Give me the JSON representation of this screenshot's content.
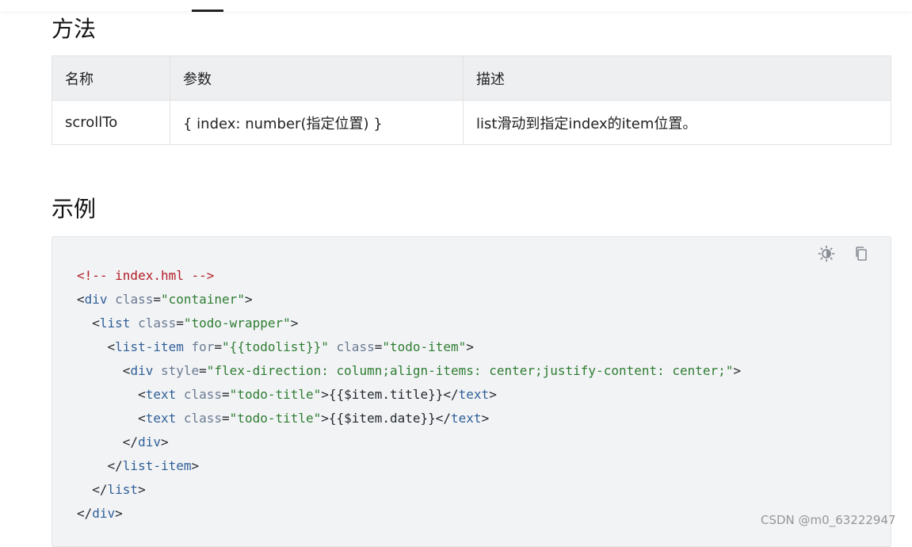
{
  "sections": {
    "methods_title": "方法",
    "example_title": "示例"
  },
  "methods_table": {
    "headers": [
      "名称",
      "参数",
      "描述"
    ],
    "rows": [
      [
        "scrollTo",
        "{ index: number(指定位置) }",
        "list滑动到指定index的item位置。"
      ]
    ]
  },
  "code_block": {
    "toolbar": {
      "theme_icon": "theme-toggle-icon",
      "copy_icon": "copy-icon"
    },
    "lines": [
      [
        [
          "comment",
          "<!-- index.hml -->"
        ]
      ],
      [
        [
          "text",
          "<"
        ],
        [
          "tag",
          "div"
        ],
        [
          "attr",
          " class"
        ],
        [
          "text",
          "="
        ],
        [
          "str",
          "\"container\""
        ],
        [
          "text",
          ">"
        ]
      ],
      [
        [
          "text",
          "  <"
        ],
        [
          "tag",
          "list"
        ],
        [
          "attr",
          " class"
        ],
        [
          "text",
          "="
        ],
        [
          "str",
          "\"todo-wrapper\""
        ],
        [
          "text",
          ">"
        ]
      ],
      [
        [
          "text",
          "    <"
        ],
        [
          "tag",
          "list-item"
        ],
        [
          "attr",
          " for"
        ],
        [
          "text",
          "="
        ],
        [
          "str",
          "\"{{todolist}}\""
        ],
        [
          "attr",
          " class"
        ],
        [
          "text",
          "="
        ],
        [
          "str",
          "\"todo-item\""
        ],
        [
          "text",
          ">"
        ]
      ],
      [
        [
          "text",
          "      <"
        ],
        [
          "tag",
          "div"
        ],
        [
          "attr",
          " style"
        ],
        [
          "text",
          "="
        ],
        [
          "str",
          "\"flex-direction: column;align-items: center;justify-content: center;\""
        ],
        [
          "text",
          ">"
        ]
      ],
      [
        [
          "text",
          "        <"
        ],
        [
          "tag",
          "text"
        ],
        [
          "attr",
          " class"
        ],
        [
          "text",
          "="
        ],
        [
          "str",
          "\"todo-title\""
        ],
        [
          "text",
          ">{{$item.title}}</"
        ],
        [
          "tag",
          "text"
        ],
        [
          "text",
          ">"
        ]
      ],
      [
        [
          "text",
          "        <"
        ],
        [
          "tag",
          "text"
        ],
        [
          "attr",
          " class"
        ],
        [
          "text",
          "="
        ],
        [
          "str",
          "\"todo-title\""
        ],
        [
          "text",
          ">{{$item.date}}</"
        ],
        [
          "tag",
          "text"
        ],
        [
          "text",
          ">"
        ]
      ],
      [
        [
          "text",
          "      </"
        ],
        [
          "tag",
          "div"
        ],
        [
          "text",
          ">"
        ]
      ],
      [
        [
          "text",
          "    </"
        ],
        [
          "tag",
          "list-item"
        ],
        [
          "text",
          ">"
        ]
      ],
      [
        [
          "text",
          "  </"
        ],
        [
          "tag",
          "list"
        ],
        [
          "text",
          ">"
        ]
      ],
      [
        [
          "text",
          "</"
        ],
        [
          "tag",
          "div"
        ],
        [
          "text",
          ">"
        ]
      ]
    ]
  },
  "watermark": "CSDN @m0_63222947"
}
